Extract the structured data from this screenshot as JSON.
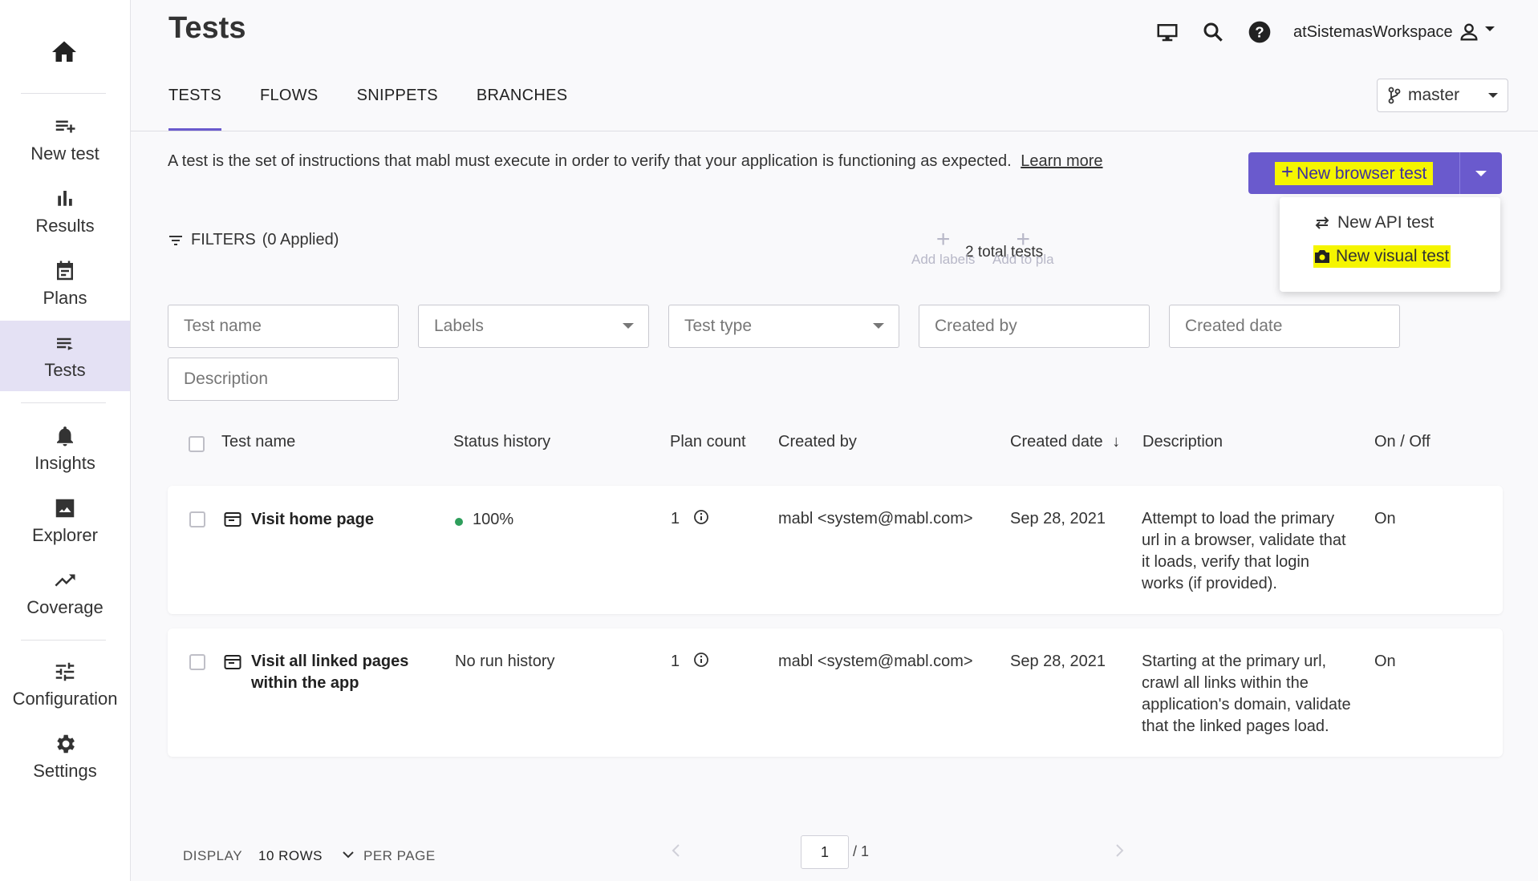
{
  "sidebar": {
    "items": [
      {
        "label": "New test",
        "icon": "playlist-add-icon"
      },
      {
        "label": "Results",
        "icon": "bar-chart-icon"
      },
      {
        "label": "Plans",
        "icon": "calendar-icon"
      },
      {
        "label": "Tests",
        "icon": "list-icon",
        "active": true
      },
      {
        "label": "Insights",
        "icon": "bell-icon"
      },
      {
        "label": "Explorer",
        "icon": "image-icon"
      },
      {
        "label": "Coverage",
        "icon": "trending-up-icon"
      },
      {
        "label": "Configuration",
        "icon": "tune-icon"
      },
      {
        "label": "Settings",
        "icon": "gear-icon"
      }
    ]
  },
  "header": {
    "title": "Tests",
    "workspace": "atSistemasWorkspace"
  },
  "tabs": [
    {
      "label": "TESTS",
      "active": true
    },
    {
      "label": "FLOWS"
    },
    {
      "label": "SNIPPETS"
    },
    {
      "label": "BRANCHES"
    }
  ],
  "branch": {
    "label": "master"
  },
  "intro": {
    "text": "A test is the set of instructions that mabl must execute in order to verify that your application is functioning as expected.",
    "link": "Learn more"
  },
  "new_button": {
    "label": "New browser test"
  },
  "new_menu": {
    "items": [
      "New API test",
      "New visual test"
    ]
  },
  "filters": {
    "label": "FILTERS",
    "applied": "(0 Applied)"
  },
  "toolbar": {
    "total": "2 total tests",
    "add_labels": "Add labels",
    "add_to_plan": "Add to pla"
  },
  "filter_fields": {
    "test_name": "Test name",
    "labels": "Labels",
    "test_type": "Test type",
    "created_by": "Created by",
    "created_date": "Created date",
    "description": "Description"
  },
  "table": {
    "columns": {
      "test_name": "Test name",
      "status_history": "Status history",
      "plan_count": "Plan count",
      "created_by": "Created by",
      "created_date": "Created date",
      "description": "Description",
      "on_off": "On / Off"
    },
    "rows": [
      {
        "name_line1": "Visit home page",
        "name_line2": "",
        "status": "100%",
        "plan_count": "1",
        "created_by": "mabl <system@mabl.com>",
        "created_date": "Sep 28, 2021",
        "description": [
          "Attempt to load the primary",
          "url in a browser, validate that",
          "it loads, verify that login",
          "works (if provided)."
        ],
        "on_off": "On"
      },
      {
        "name_line1": "Visit all linked pages",
        "name_line2": "within the app",
        "status": "No run history",
        "plan_count": "1",
        "created_by": "mabl <system@mabl.com>",
        "created_date": "Sep 28, 2021",
        "description": [
          "Starting at the primary url,",
          "crawl all links within the",
          "application's domain, validate",
          "that the linked pages load."
        ],
        "on_off": "On"
      }
    ]
  },
  "pagination": {
    "display": "DISPLAY",
    "rows": "10 ROWS",
    "per_page": "PER PAGE",
    "page": "1",
    "total_pages": "/ 1"
  },
  "colors": {
    "accent": "#6a5acd",
    "highlight": "#f5f500",
    "status_green": "#2e9e5b"
  }
}
